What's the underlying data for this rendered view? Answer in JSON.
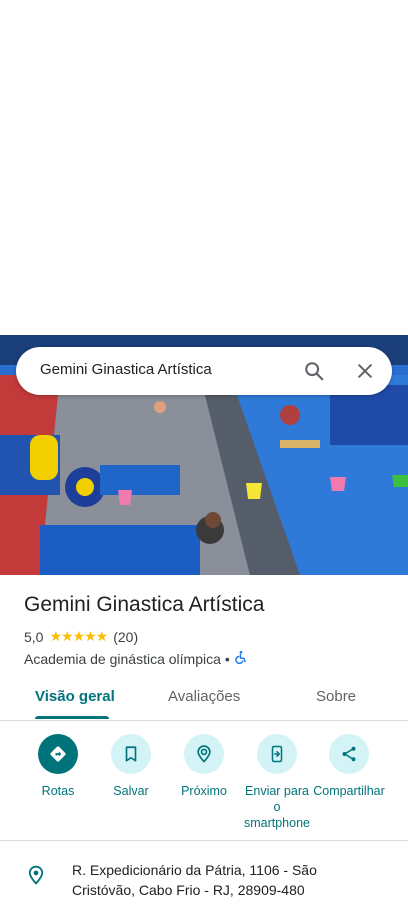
{
  "search": {
    "query": "Gemini Ginastica Artística"
  },
  "place": {
    "name": "Gemini Ginastica Artística",
    "rating": "5,0",
    "stars": "★★★★★",
    "review_count": "(20)",
    "category": "Academia de ginástica olímpica",
    "separator": "•"
  },
  "tabs": [
    {
      "label": "Visão geral",
      "active": true
    },
    {
      "label": "Avaliações",
      "active": false
    },
    {
      "label": "Sobre",
      "active": false
    }
  ],
  "actions": [
    {
      "label": "Rotas",
      "icon": "directions-icon"
    },
    {
      "label": "Salvar",
      "icon": "bookmark-icon"
    },
    {
      "label": "Próximo",
      "icon": "nearby-icon"
    },
    {
      "label": "Enviar para o smartphone",
      "icon": "send-to-phone-icon"
    },
    {
      "label": "Compartilhar",
      "icon": "share-icon"
    }
  ],
  "address": "R. Expedicionário da Pátria, 1106 - São Cristóvão, Cabo Frio - RJ, 28909-480",
  "colors": {
    "accent": "#00747a",
    "chip": "#d3f3f7",
    "star": "#fbbc04"
  }
}
